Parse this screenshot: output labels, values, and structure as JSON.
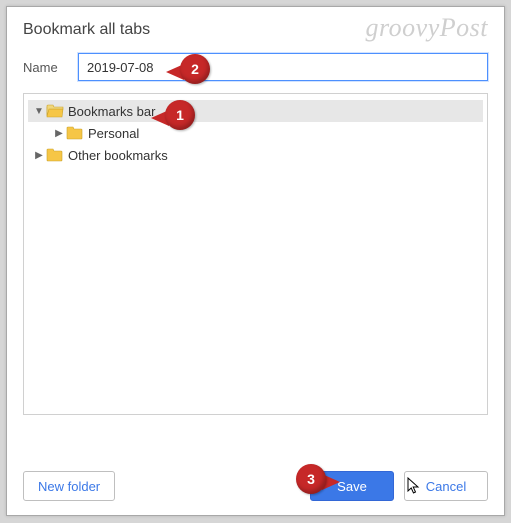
{
  "watermark": "groovyPost",
  "dialog": {
    "title": "Bookmark all tabs",
    "name_label": "Name",
    "name_value": "2019-07-08"
  },
  "tree": {
    "items": [
      {
        "label": "Bookmarks bar",
        "expanded": true,
        "selected": true,
        "indent": 1
      },
      {
        "label": "Personal",
        "expanded": false,
        "selected": false,
        "indent": 2,
        "has_children": true
      },
      {
        "label": "Other bookmarks",
        "expanded": false,
        "selected": false,
        "indent": 1,
        "has_children": true
      }
    ]
  },
  "footer": {
    "new_folder": "New folder",
    "save": "Save",
    "cancel": "Cancel"
  },
  "annotations": {
    "step1": "1",
    "step2": "2",
    "step3": "3"
  }
}
